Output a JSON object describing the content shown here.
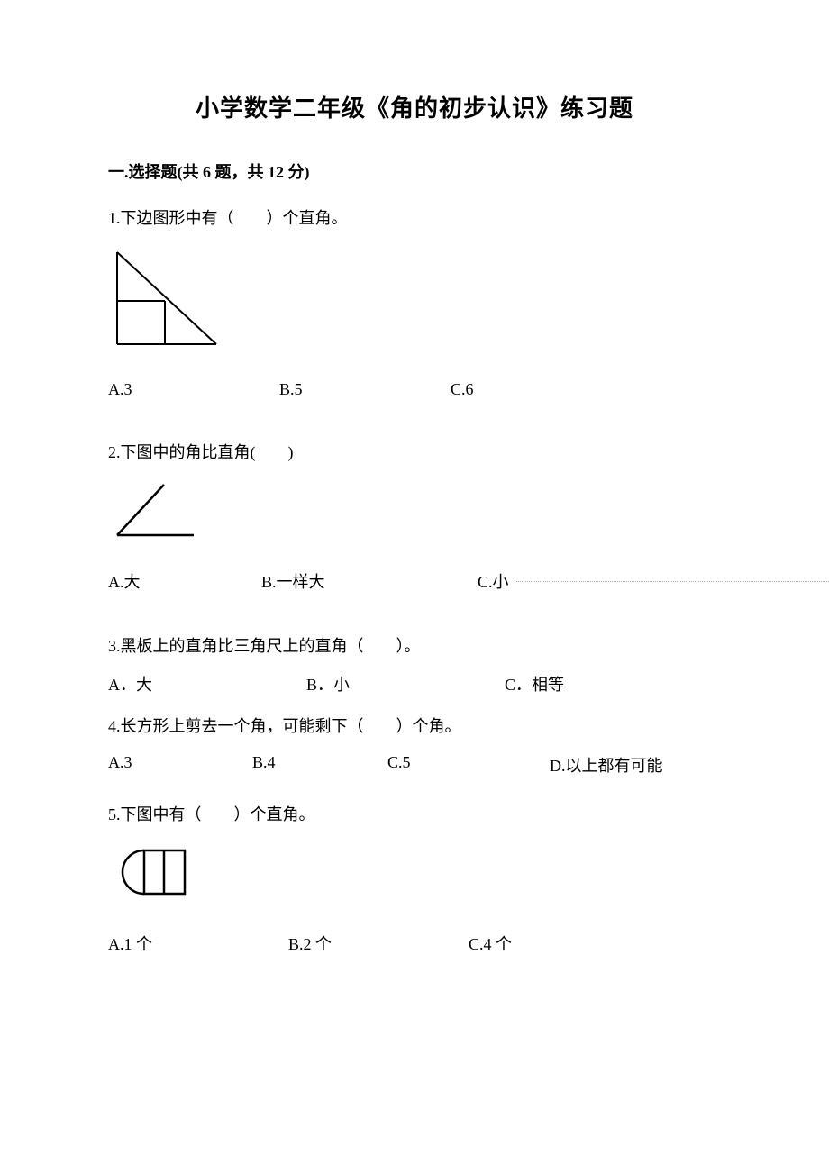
{
  "title": "小学数学二年级《角的初步认识》练习题",
  "section1": {
    "header": "一.选择题(共 6 题，共 12 分)",
    "q1": {
      "text": "1.下边图形中有（　　）个直角。",
      "optA": "A.3",
      "optB": "B.5",
      "optC": "C.6"
    },
    "q2": {
      "text": "2.下图中的角比直角(　　)",
      "optA": "A.大",
      "optB": "B.一样大",
      "optC": "C.小"
    },
    "q3": {
      "text": "3.黑板上的直角比三角尺上的直角（　　）。",
      "optA": "A．大",
      "optB": "B．小",
      "optC": "C．相等"
    },
    "q4": {
      "text": "4.长方形上剪去一个角，可能剩下（　　）个角。",
      "optA": "A.3",
      "optB": "B.4",
      "optC": "C.5",
      "optD": "D.以上都有可能"
    },
    "q5": {
      "text": "5.下图中有（　　）个直角。",
      "optA": "A.1 个",
      "optB": "B.2 个",
      "optC": "C.4 个"
    }
  }
}
